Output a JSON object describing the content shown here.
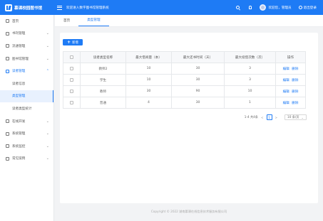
{
  "header": {
    "app_title": "慕课校园图书馆",
    "welcome": "欢迎进入数字图书馆管理系统",
    "user": "欢迎您，管理员",
    "logout": "退出登录"
  },
  "sidebar": {
    "items": [
      {
        "label": "首页",
        "icon": "home-icon",
        "arrow": ""
      },
      {
        "label": "书刊管理",
        "icon": "book-icon",
        "arrow": "⌄"
      },
      {
        "label": "流通管理",
        "icon": "circulation-icon",
        "arrow": "⌄"
      },
      {
        "label": "图书馆管理",
        "icon": "library-icon",
        "arrow": "⌄"
      },
      {
        "label": "读者管理",
        "icon": "reader-icon",
        "arrow": "⌃"
      },
      {
        "label": "在线开发",
        "icon": "code-icon",
        "arrow": "⌄"
      },
      {
        "label": "系统管理",
        "icon": "gear-icon",
        "arrow": "⌄"
      },
      {
        "label": "系统监控",
        "icon": "monitor-icon",
        "arrow": "⌄"
      },
      {
        "label": "常见案例",
        "icon": "case-icon",
        "arrow": "⌄"
      }
    ],
    "sub_items": [
      "读者信息",
      "类型管理",
      "读者类型统计"
    ]
  },
  "tabs": [
    "首页",
    "类型管理"
  ],
  "toolbar": {
    "add_label": "新增"
  },
  "table": {
    "headers": [
      "",
      "读者类型名称",
      "最大借阅量（本）",
      "最大还书时间（天）",
      "最大续借次数（次）",
      "操作"
    ],
    "rows": [
      {
        "name": "教师2",
        "max_borrow": "10",
        "max_days": "30",
        "max_renew": "3"
      },
      {
        "name": "学生",
        "max_borrow": "10",
        "max_days": "30",
        "max_renew": "3"
      },
      {
        "name": "教师",
        "max_borrow": "30",
        "max_days": "90",
        "max_renew": "10"
      },
      {
        "name": "普通",
        "max_borrow": "4",
        "max_days": "30",
        "max_renew": "1"
      }
    ],
    "edit_label": "编辑",
    "delete_label": "删除"
  },
  "pagination": {
    "summary": "1-4 共4条",
    "prev": "<",
    "current_page": "1",
    "next": ">",
    "page_size": "10 条/页"
  },
  "footer": {
    "copyright": "Copyright © 2022 湖南慕课在线信息技术服务有限公司"
  },
  "colors": {
    "primary": "#1e7bf5"
  }
}
